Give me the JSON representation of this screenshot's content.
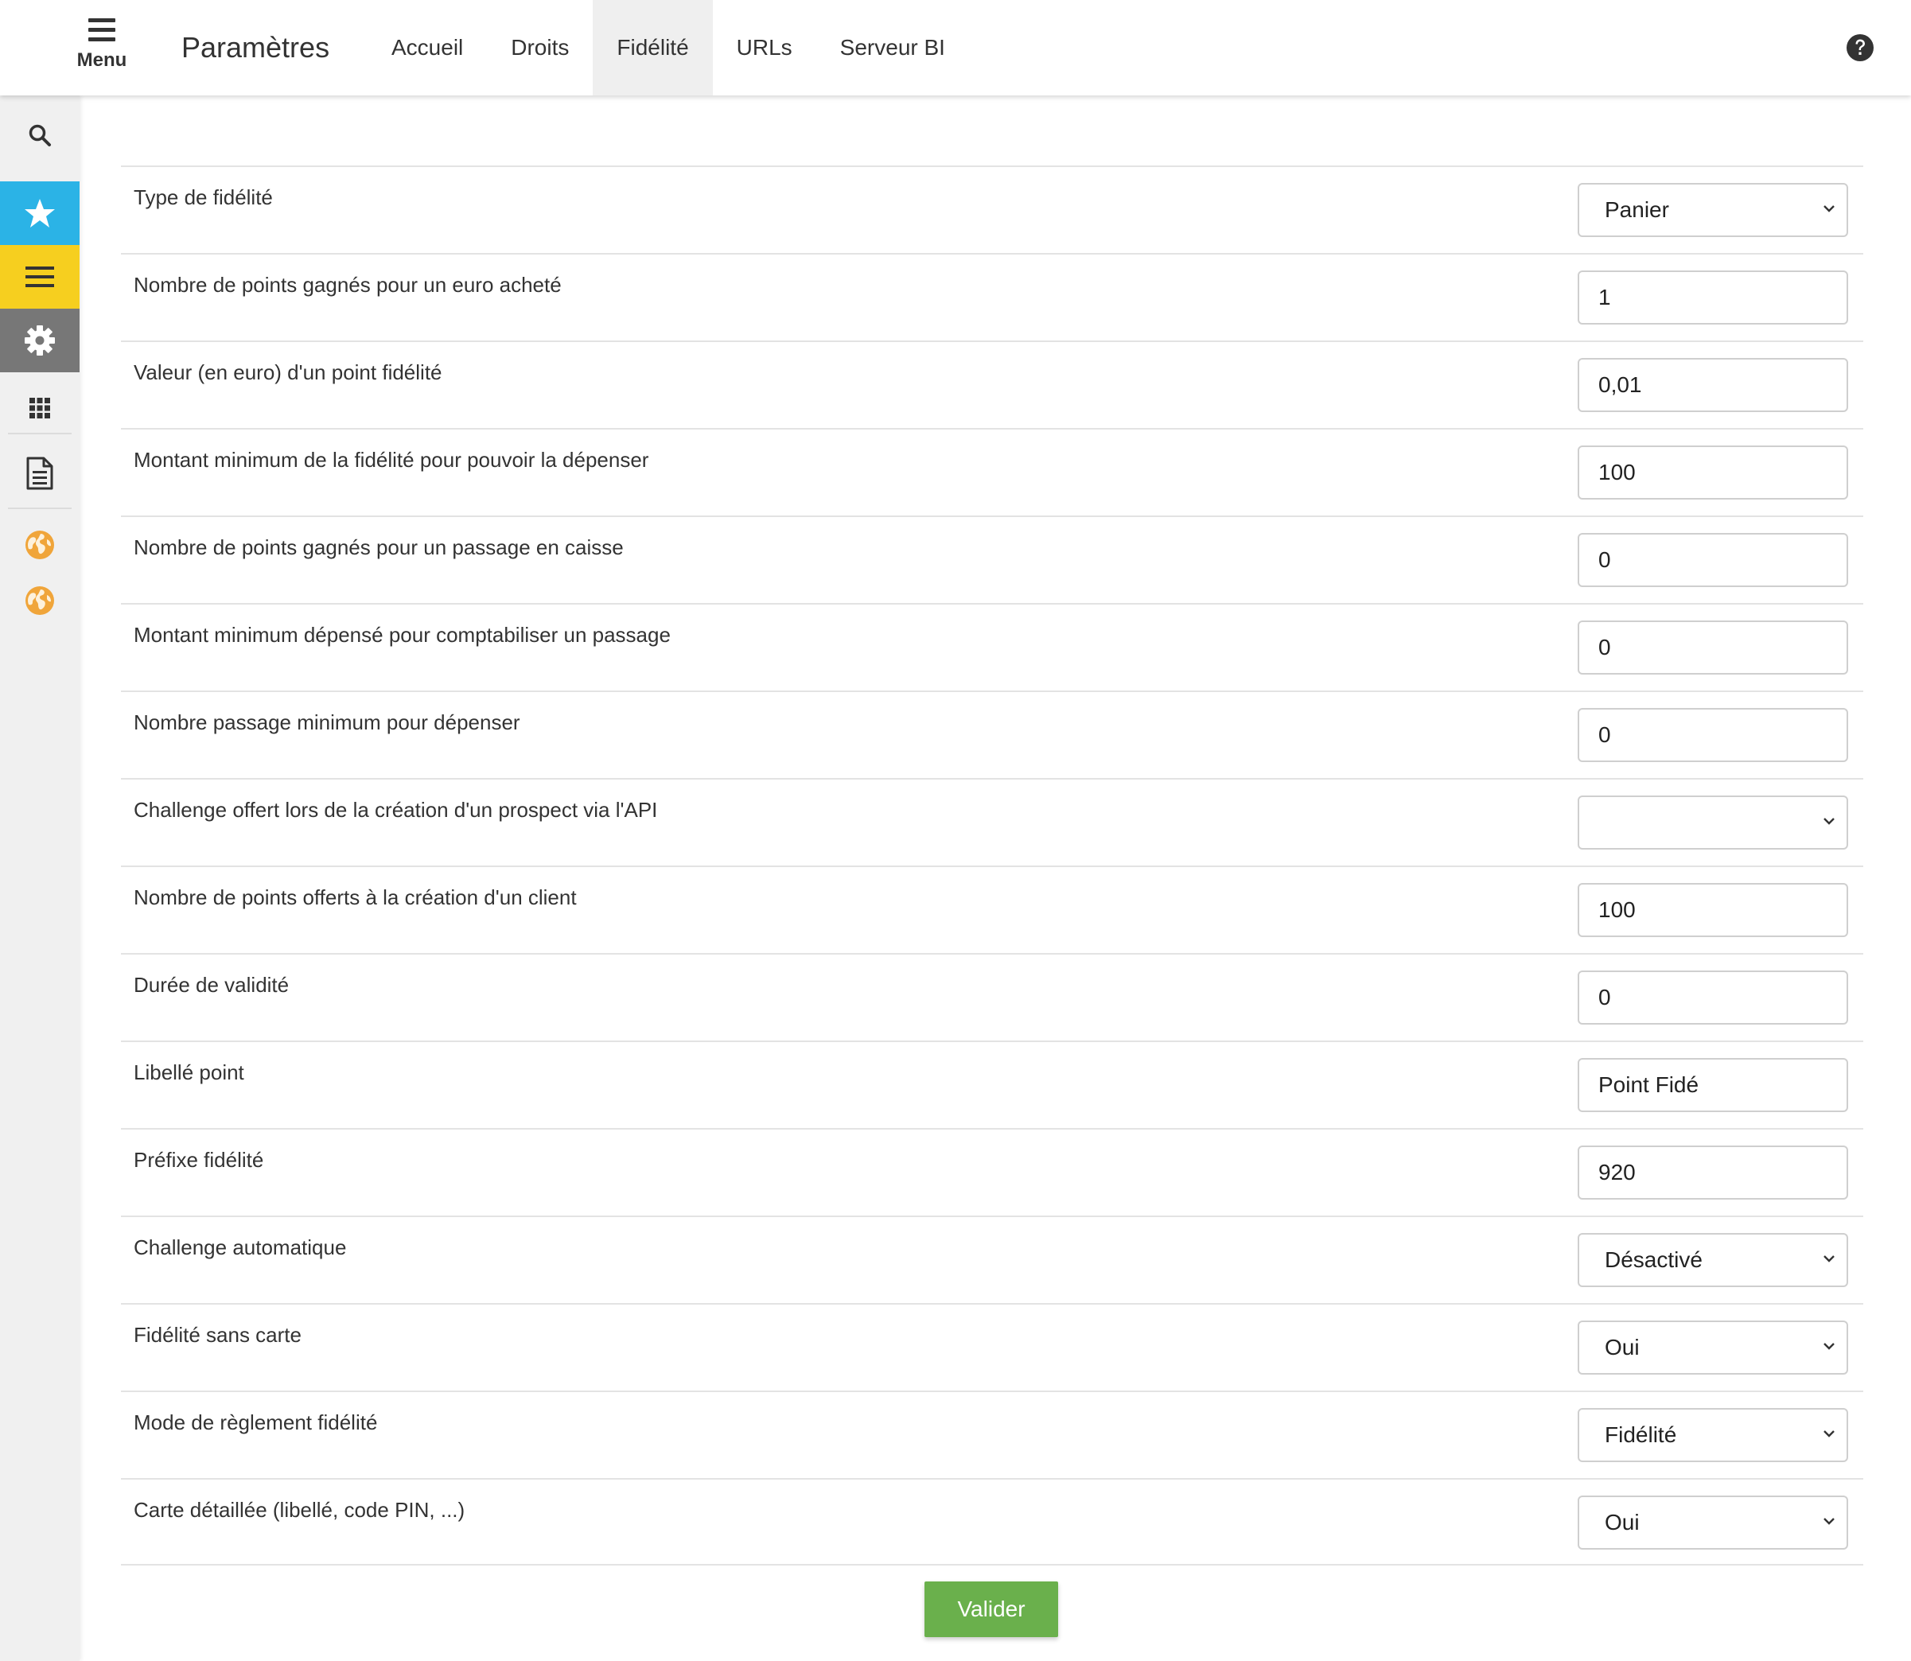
{
  "header": {
    "menu_label": "Menu",
    "title": "Paramètres",
    "tabs": [
      {
        "label": "Accueil",
        "active": false
      },
      {
        "label": "Droits",
        "active": false
      },
      {
        "label": "Fidélité",
        "active": true
      },
      {
        "label": "URLs",
        "active": false
      },
      {
        "label": "Serveur BI",
        "active": false
      }
    ],
    "help_icon": "question-circle-icon"
  },
  "sidebar": {
    "items": [
      {
        "icon": "search-icon"
      },
      {
        "icon": "star-icon",
        "color": "#2bb3e6"
      },
      {
        "icon": "list-icon",
        "color": "#f6cf1f"
      },
      {
        "icon": "gear-icon",
        "color": "#777777"
      },
      {
        "icon": "apps-grid-icon"
      },
      {
        "icon": "document-icon"
      },
      {
        "icon": "globe-icon",
        "color": "#f0a53a"
      },
      {
        "icon": "globe-icon",
        "color": "#f0a53a"
      }
    ]
  },
  "form": {
    "rows": [
      {
        "label": "Type de fidélité",
        "type": "select",
        "value": "Panier"
      },
      {
        "label": "Nombre de points gagnés pour un euro acheté",
        "type": "input",
        "value": "1"
      },
      {
        "label": "Valeur (en euro) d'un point fidélité",
        "type": "input",
        "value": "0,01"
      },
      {
        "label": "Montant minimum de la fidélité pour pouvoir la dépenser",
        "type": "input",
        "value": "100"
      },
      {
        "label": "Nombre de points gagnés pour un passage en caisse",
        "type": "input",
        "value": "0"
      },
      {
        "label": "Montant minimum dépensé pour comptabiliser un passage",
        "type": "input",
        "value": "0"
      },
      {
        "label": "Nombre passage minimum pour dépenser",
        "type": "input",
        "value": "0"
      },
      {
        "label": "Challenge offert lors de la création d'un prospect via l'API",
        "type": "select",
        "value": ""
      },
      {
        "label": "Nombre de points offerts à la création d'un client",
        "type": "input",
        "value": "100"
      },
      {
        "label": "Durée de validité",
        "type": "input",
        "value": "0"
      },
      {
        "label": "Libellé point",
        "type": "input",
        "value": "Point Fidé"
      },
      {
        "label": "Préfixe fidélité",
        "type": "input",
        "value": "920"
      },
      {
        "label": "Challenge automatique",
        "type": "select",
        "value": "Désactivé"
      },
      {
        "label": "Fidélité sans carte",
        "type": "select",
        "value": "Oui"
      },
      {
        "label": "Mode de règlement fidélité",
        "type": "select",
        "value": "Fidélité"
      },
      {
        "label": "Carte détaillée (libellé, code PIN, ...)",
        "type": "select",
        "value": "Oui"
      }
    ],
    "submit_label": "Valider"
  },
  "colors": {
    "accent_green": "#6ab04c",
    "active_tab_bg": "#efefef",
    "sidebar_bg": "#f0f0f0"
  }
}
